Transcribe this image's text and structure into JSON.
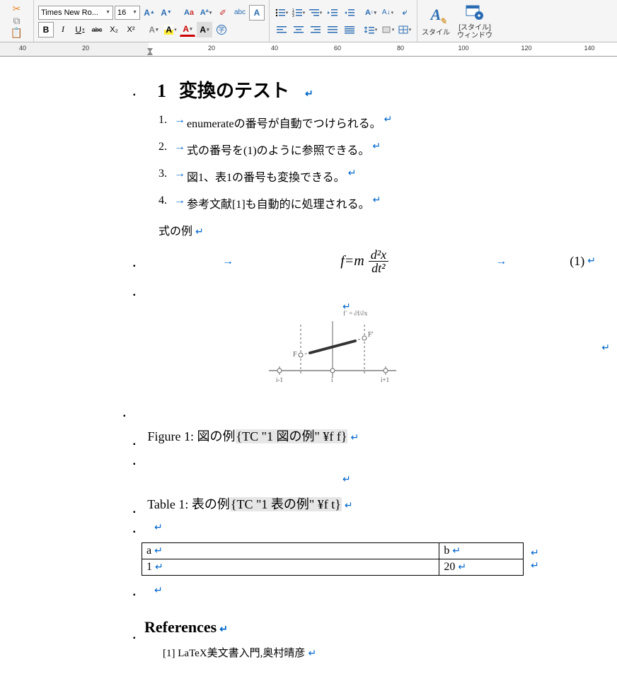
{
  "toolbar": {
    "font_name": "Times New Ro...",
    "font_size": "16",
    "bold": "B",
    "italic": "I",
    "underline": "U",
    "strike": "abc",
    "sub": "X₂",
    "sup": "X²",
    "style_label": "スタイル",
    "style_window_label": "[スタイル]\nウィンドウ"
  },
  "ruler": {
    "start": -40,
    "active_from": 0,
    "end": 140,
    "step": 20,
    "labels": [
      "40",
      "20",
      "",
      "20",
      "40",
      "60",
      "80",
      "100",
      "120",
      "140"
    ]
  },
  "heading": {
    "num": "1",
    "title": "変換のテスト"
  },
  "list": [
    {
      "n": "1.",
      "text": "enumerateの番号が自動でつけられる。"
    },
    {
      "n": "2.",
      "text": "式の番号を(1)のように参照できる。"
    },
    {
      "n": "3.",
      "text": "図1、表1の番号も変換できる。"
    },
    {
      "n": "4.",
      "text": "参考文献[1]も自動的に処理される。"
    }
  ],
  "equation_label": "式の例",
  "equation": {
    "lhs": "f=m",
    "frac_top": "d²x",
    "frac_bot": "dt²",
    "number": "(1)"
  },
  "diagram": {
    "caption_f": "f` = ∂f/∂x",
    "F": "F",
    "Fp": "F'",
    "im1": "i-1",
    "i": "i",
    "ip1": "i+1"
  },
  "figure_caption": {
    "prefix": "Figure 1:  図の例",
    "field": "{TC \"1  図の例\" ¥f f}"
  },
  "table_caption": {
    "prefix": "Table 1:  表の例",
    "field": "{TC \"1  表の例\" ¥f t}"
  },
  "table": {
    "headers": [
      "a",
      "b"
    ],
    "row": [
      "1",
      "20"
    ]
  },
  "refs_heading": "References",
  "refs": [
    {
      "n": "[1]",
      "text": "LaTeX美文書入門,奥村晴彦"
    }
  ]
}
